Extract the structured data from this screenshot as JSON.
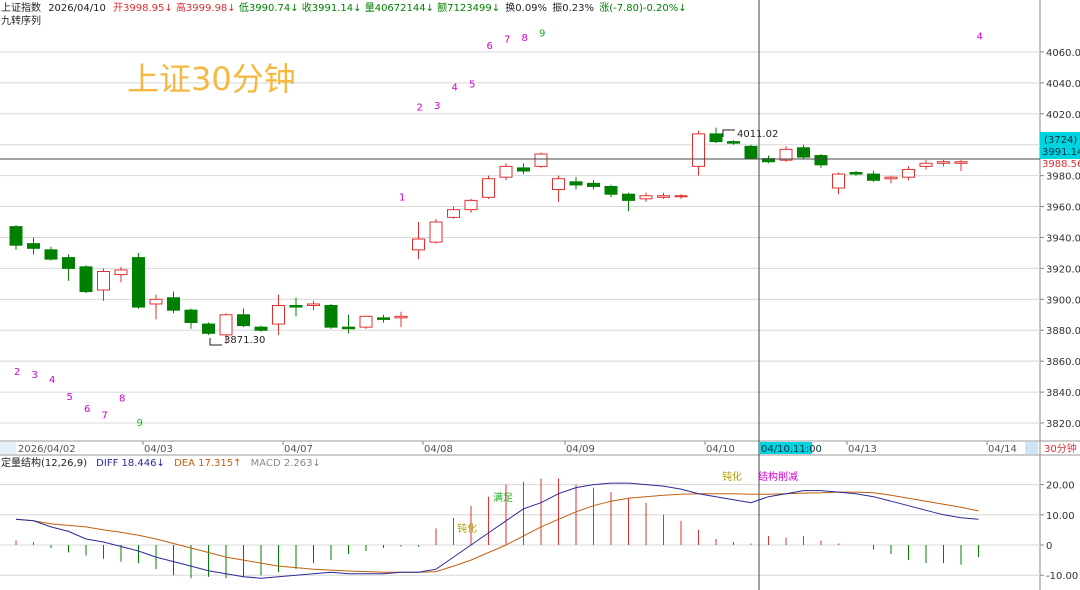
{
  "header": {
    "name": "上证指数",
    "date": "2026/04/10",
    "open": "开3998.95↓",
    "high": "高3999.98↓",
    "low": "低3990.74↓",
    "close": "收3991.14↓",
    "volume": "量40672144↓",
    "amount": "额7123499↓",
    "turnover": "换0.09%",
    "amplitude": "振0.23%",
    "change": "涨(-7.80)-0.20%↓",
    "indicator": "九转序列"
  },
  "watermark": "上证30分钟",
  "price_axis": {
    "ticks": [
      "4060.00",
      "4040.00",
      "4020.00",
      "4000.00",
      "3980.00",
      "3960.00",
      "3940.00",
      "3920.00",
      "3900.00",
      "3880.00",
      "3860.00",
      "3840.00",
      "3820.00"
    ],
    "badge_top": "(3724)",
    "badge_price": "3991.14",
    "ref_price": "3988.56"
  },
  "date_axis": {
    "labels": [
      "2026/04/02",
      "04/03",
      "04/07",
      "04/08",
      "04/09",
      "04/10",
      "04/13",
      "04/14"
    ],
    "cursor_label": "04/10,11:00",
    "period_label": "30分钟"
  },
  "annotations": {
    "high_label": "4011.02",
    "low_label": "3871.30"
  },
  "macd": {
    "title": "定量结构(12,26,9)",
    "diff": "DIFF 18.446↓",
    "dea": "DEA 17.315↑",
    "macd": "MACD 2.263↓",
    "ticks": [
      "20.00",
      "10.00",
      "0",
      "-10.00"
    ],
    "label_dunhua": "钝化",
    "label_jiegou": "结构削减",
    "label_dunhua_small": "钝化",
    "label_green_small": "满足"
  },
  "colors": {
    "up": "#e03030",
    "down": "#008000",
    "diff": "#2a2a9a",
    "dea": "#c06010",
    "cursor_bg": "#00c8d8",
    "watermark": "#f5b942",
    "nine": "#d000d0"
  },
  "chart_data": {
    "type": "candlestick",
    "period": "30分钟",
    "y_axis": [
      3810,
      4075
    ],
    "candles": [
      {
        "date": "04/02",
        "o": 3947,
        "h": 3948,
        "c": 3935,
        "l": 3932
      },
      {
        "date": "04/02",
        "o": 3936,
        "h": 3940,
        "c": 3933,
        "l": 3929
      },
      {
        "date": "04/02",
        "o": 3932,
        "h": 3934,
        "c": 3926,
        "l": 3925
      },
      {
        "date": "04/02",
        "o": 3927,
        "h": 3929,
        "c": 3920,
        "l": 3912
      },
      {
        "date": "04/02",
        "o": 3921,
        "h": 3922,
        "c": 3905,
        "l": 3904
      },
      {
        "date": "04/02",
        "o": 3906,
        "h": 3920,
        "c": 3918,
        "l": 3899
      },
      {
        "date": "04/02",
        "o": 3916,
        "h": 3921,
        "c": 3919,
        "l": 3911
      },
      {
        "date": "04/03",
        "o": 3927,
        "h": 3930,
        "c": 3895,
        "l": 3894
      },
      {
        "date": "04/03",
        "o": 3897,
        "h": 3903,
        "c": 3900,
        "l": 3887
      },
      {
        "date": "04/03",
        "o": 3901,
        "h": 3905,
        "c": 3893,
        "l": 3891
      },
      {
        "date": "04/03",
        "o": 3893,
        "h": 3894,
        "c": 3885,
        "l": 3881
      },
      {
        "date": "04/03",
        "o": 3884,
        "h": 3885,
        "c": 3878,
        "l": 3877
      },
      {
        "date": "04/03",
        "o": 3877,
        "h": 3891,
        "c": 3890,
        "l": 3871.3
      },
      {
        "date": "04/03",
        "o": 3890,
        "h": 3894,
        "c": 3883,
        "l": 3882
      },
      {
        "date": "04/03",
        "o": 3882,
        "h": 3883,
        "c": 3880,
        "l": 3879
      },
      {
        "date": "04/07",
        "o": 3884,
        "h": 3903,
        "c": 3896,
        "l": 3877
      },
      {
        "date": "04/07",
        "o": 3896,
        "h": 3901,
        "c": 3895,
        "l": 3889
      },
      {
        "date": "04/07",
        "o": 3896,
        "h": 3899,
        "c": 3897,
        "l": 3893
      },
      {
        "date": "04/07",
        "o": 3896,
        "h": 3897,
        "c": 3882,
        "l": 3881
      },
      {
        "date": "04/07",
        "o": 3882,
        "h": 3890,
        "c": 3881,
        "l": 3878
      },
      {
        "date": "04/07",
        "o": 3882,
        "h": 3889,
        "c": 3889,
        "l": 3881
      },
      {
        "date": "04/07",
        "o": 3888,
        "h": 3890,
        "c": 3887,
        "l": 3885
      },
      {
        "date": "04/07",
        "o": 3888,
        "h": 3892,
        "c": 3889,
        "l": 3882
      },
      {
        "date": "04/08",
        "o": 3932,
        "h": 3950,
        "c": 3939,
        "l": 3926
      },
      {
        "date": "04/08",
        "o": 3937,
        "h": 3952,
        "c": 3950,
        "l": 3936
      },
      {
        "date": "04/08",
        "o": 3953,
        "h": 3960,
        "c": 3958,
        "l": 3952
      },
      {
        "date": "04/08",
        "o": 3958,
        "h": 3965,
        "c": 3964,
        "l": 3956
      },
      {
        "date": "04/08",
        "o": 3966,
        "h": 3980,
        "c": 3978,
        "l": 3965
      },
      {
        "date": "04/08",
        "o": 3979,
        "h": 3988,
        "c": 3986,
        "l": 3977
      },
      {
        "date": "04/08",
        "o": 3985,
        "h": 3988,
        "c": 3983,
        "l": 3981
      },
      {
        "date": "04/08",
        "o": 3986,
        "h": 3995,
        "c": 3994,
        "l": 3985
      },
      {
        "date": "04/09",
        "o": 3971,
        "h": 3980,
        "c": 3978,
        "l": 3963
      },
      {
        "date": "04/09",
        "o": 3976,
        "h": 3979,
        "c": 3974,
        "l": 3971
      },
      {
        "date": "04/09",
        "o": 3975,
        "h": 3977,
        "c": 3973,
        "l": 3971
      },
      {
        "date": "04/09",
        "o": 3973,
        "h": 3974,
        "c": 3968,
        "l": 3966
      },
      {
        "date": "04/09",
        "o": 3968,
        "h": 3969,
        "c": 3964,
        "l": 3957
      },
      {
        "date": "04/09",
        "o": 3965,
        "h": 3969,
        "c": 3967,
        "l": 3963
      },
      {
        "date": "04/09",
        "o": 3966,
        "h": 3969,
        "c": 3967,
        "l": 3965
      },
      {
        "date": "04/09",
        "o": 3967,
        "h": 3968,
        "c": 3967,
        "l": 3965
      },
      {
        "date": "04/10",
        "o": 3986,
        "h": 4009,
        "c": 4007,
        "l": 3980
      },
      {
        "date": "04/10",
        "o": 4007,
        "h": 4011.02,
        "c": 4002,
        "l": 4001
      },
      {
        "date": "04/10",
        "o": 4002,
        "h": 4003,
        "c": 4001,
        "l": 4000
      },
      {
        "date": "04/10",
        "o": 3998.95,
        "h": 3999.98,
        "c": 3991.14,
        "l": 3990.74
      },
      {
        "date": "04/10",
        "o": 3991,
        "h": 3993,
        "c": 3989,
        "l": 3988
      },
      {
        "date": "04/10",
        "o": 3990,
        "h": 3999,
        "c": 3997,
        "l": 3989
      },
      {
        "date": "04/10",
        "o": 3998,
        "h": 4000,
        "c": 3992,
        "l": 3991
      },
      {
        "date": "04/10",
        "o": 3993,
        "h": 3994,
        "c": 3987,
        "l": 3985
      },
      {
        "date": "04/13",
        "o": 3972,
        "h": 3982,
        "c": 3981,
        "l": 3968
      },
      {
        "date": "04/13",
        "o": 3982,
        "h": 3983,
        "c": 3981,
        "l": 3980
      },
      {
        "date": "04/13",
        "o": 3981,
        "h": 3983,
        "c": 3977,
        "l": 3976
      },
      {
        "date": "04/13",
        "o": 3978,
        "h": 3980,
        "c": 3979,
        "l": 3975
      },
      {
        "date": "04/13",
        "o": 3979,
        "h": 3986,
        "c": 3984,
        "l": 3977
      },
      {
        "date": "04/13",
        "o": 3986,
        "h": 3990,
        "c": 3988,
        "l": 3984
      },
      {
        "date": "04/13",
        "o": 3988,
        "h": 3990,
        "c": 3989,
        "l": 3986
      },
      {
        "date": "04/13",
        "o": 3988,
        "h": 3990,
        "c": 3989,
        "l": 3983
      }
    ],
    "nine_sequence": [
      {
        "i": 0,
        "n": "2",
        "v": 3851
      },
      {
        "i": 1,
        "n": "3",
        "v": 3849
      },
      {
        "i": 2,
        "n": "4",
        "v": 3846
      },
      {
        "i": 3,
        "n": "5",
        "v": 3835
      },
      {
        "i": 4,
        "n": "6",
        "v": 3827
      },
      {
        "i": 5,
        "n": "7",
        "v": 3823
      },
      {
        "i": 6,
        "n": "8",
        "v": 3834
      },
      {
        "i": 7,
        "n": "9",
        "v": 3818
      },
      {
        "i": 22,
        "n": "1",
        "v": 3964
      },
      {
        "i": 23,
        "n": "2",
        "v": 4022
      },
      {
        "i": 24,
        "n": "3",
        "v": 4023
      },
      {
        "i": 25,
        "n": "4",
        "v": 4035
      },
      {
        "i": 26,
        "n": "5",
        "v": 4037
      },
      {
        "i": 27,
        "n": "6",
        "v": 4062
      },
      {
        "i": 28,
        "n": "7",
        "v": 4066
      },
      {
        "i": 29,
        "n": "8",
        "v": 4067
      },
      {
        "i": 30,
        "n": "9",
        "v": 4070
      },
      {
        "i": 55,
        "n": "4",
        "v": 4068
      }
    ],
    "macd_y_axis": [
      -11,
      27
    ],
    "macd_series": {
      "diff": [
        8.5,
        8,
        6,
        4.5,
        2,
        1,
        -0.5,
        -2,
        -4,
        -5.5,
        -7,
        -8.5,
        -9.5,
        -10.5,
        -11,
        -10.5,
        -10,
        -9.5,
        -9,
        -9.5,
        -9.5,
        -9.5,
        -9,
        -9,
        -8,
        -4,
        0,
        4,
        8,
        12,
        14,
        17,
        19,
        20,
        20.5,
        20.5,
        20,
        19.5,
        18.5,
        17,
        16,
        15,
        14,
        16,
        17,
        18,
        18,
        17.5,
        17,
        16,
        14.5,
        13,
        11.5,
        10,
        9,
        8.5
      ],
      "dea": [
        8.5,
        8,
        7,
        6.5,
        6,
        5,
        4.2,
        3.2,
        2,
        0.5,
        -1,
        -2.5,
        -4,
        -5,
        -6,
        -7,
        -7.5,
        -8,
        -8.3,
        -8.6,
        -8.8,
        -9,
        -9,
        -9,
        -8.8,
        -7,
        -5,
        -2.5,
        0,
        3,
        6,
        8.5,
        11,
        13,
        14.5,
        15.5,
        16,
        16.5,
        16.8,
        17,
        17,
        17,
        16.8,
        16.8,
        17,
        17.2,
        17.3,
        17.5,
        17.5,
        17.3,
        16.5,
        15.5,
        14.5,
        13.5,
        12.5,
        11.3
      ],
      "macd": [
        1.5,
        1,
        -1,
        -2.5,
        -3.5,
        -4.5,
        -5.5,
        -6,
        -8,
        -10,
        -11,
        -10.5,
        -11,
        -10.5,
        -10,
        -9,
        -8,
        -6,
        -5,
        -3,
        -2,
        -1,
        -0.5,
        -0.5,
        5.5,
        9,
        13,
        16,
        20,
        21,
        22,
        22,
        20,
        19,
        17.5,
        15.5,
        14,
        10,
        8,
        5,
        2,
        1,
        0.5,
        3,
        2.5,
        3,
        1.5,
        0.5,
        0,
        -1.5,
        -3,
        -5,
        -6,
        -6,
        -6.5,
        -4
      ]
    }
  }
}
